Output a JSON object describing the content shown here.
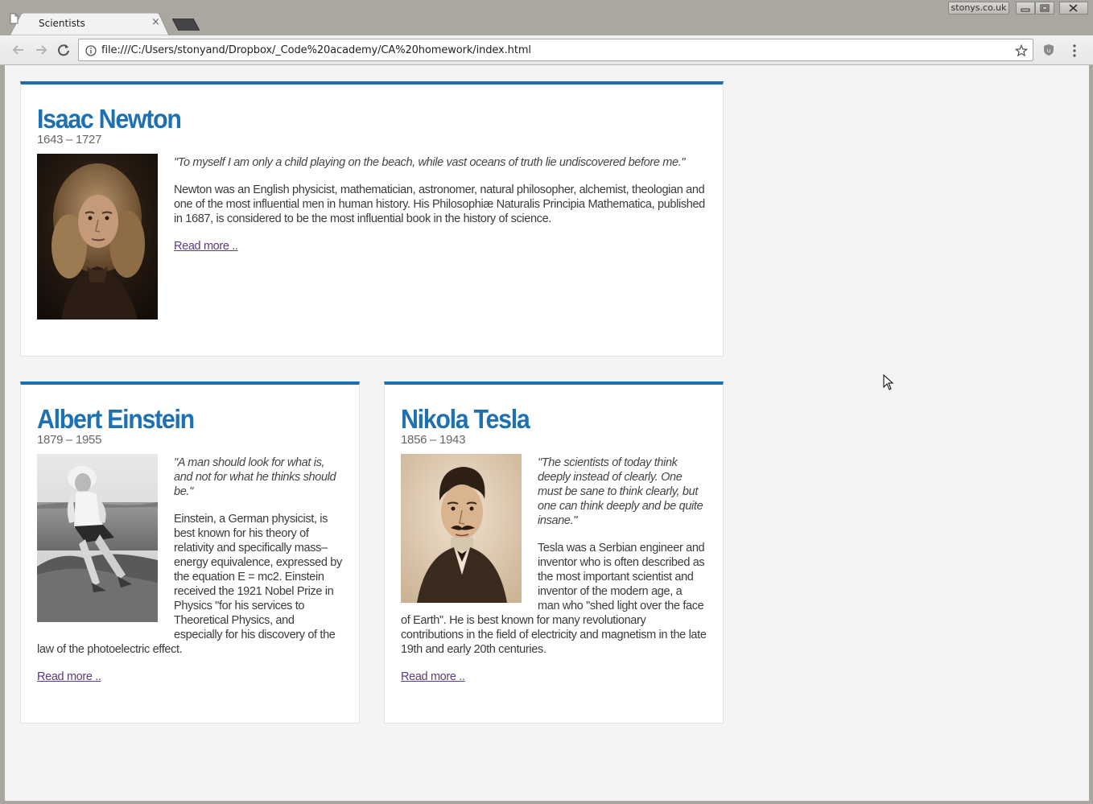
{
  "browser": {
    "tab_title": "Scientists",
    "tab_close": "×",
    "profile_name": "stonys.co.uk",
    "url": "file:///C:/Users/stonyand/Dropbox/_Code%20academy/CA%20homework/index.html"
  },
  "icons": {
    "tab": "document-icon",
    "back": "back-arrow-icon",
    "forward": "forward-arrow-icon",
    "reload": "reload-icon",
    "info": "info-icon",
    "bookmark": "star-icon",
    "extension": "ublock-icon",
    "menu": "kebab-menu-icon"
  },
  "colors": {
    "accent": "#1b6fb0",
    "link": "#5b3a88",
    "page_bg": "#f4f4f4"
  },
  "scientists": {
    "newton": {
      "name": "Isaac Newton",
      "dates": "1643 – 1727",
      "quote": "\"To myself I am only a child playing on the beach, while vast oceans of truth lie undiscovered before me.\"",
      "description": "Newton was an English physicist, mathematician, astronomer, natural philosopher, alchemist, theologian and one of the most influential men in human history. His Philosophiæ Naturalis Principia Mathematica, published in 1687, is considered to be the most influential book in the history of science.",
      "read_more": "Read more .."
    },
    "einstein": {
      "name": "Albert Einstein",
      "dates": "1879 – 1955",
      "quote": "\"A man should look for what is, and not for what he thinks should be.\"",
      "description": "Einstein, a German physicist, is best known for his theory of relativity and specifically mass–energy equivalence, expressed by the equation E = mc2. Einstein received the 1921 Nobel Prize in Physics \"for his services to Theoretical Physics, and especially for his discovery of the law of the photoelectric effect.",
      "read_more": "Read more .."
    },
    "tesla": {
      "name": "Nikola Tesla",
      "dates": "1856 – 1943",
      "quote": "\"The scientists of today think deeply instead of clearly. One must be sane to think clearly, but one can think deeply and be quite insane.\"",
      "description": "Tesla was a Serbian engineer and inventor who is often described as the most important scientist and inventor of the modern age, a man who \"shed light over the face of Earth\". He is best known for many revolutionary contributions in the field of electricity and magnetism in the late 19th and early 20th centuries.",
      "read_more": "Read more .."
    }
  }
}
